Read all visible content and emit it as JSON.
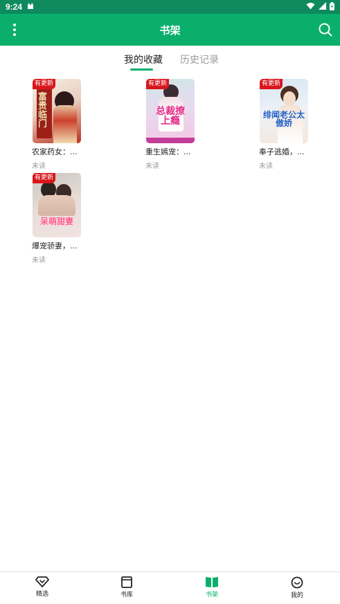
{
  "status": {
    "time": "9:24"
  },
  "header": {
    "title": "书架"
  },
  "tabs": [
    {
      "label": "我的收藏",
      "active": true
    },
    {
      "label": "历史记录",
      "active": false
    }
  ],
  "books": [
    {
      "title": "农家药女：...",
      "status": "未读",
      "badge": "有更新",
      "cover_text": "富贵临门"
    },
    {
      "title": "重生嫣宠：...",
      "status": "未读",
      "badge": "有更新",
      "cover_text": "总裁撩上瘾"
    },
    {
      "title": "奉子逃婚，...",
      "status": "未读",
      "badge": "有更新",
      "cover_text": "绯闻老公太傲娇"
    },
    {
      "title": "爆宠骄妻，...",
      "status": "未读",
      "badge": "有更新",
      "cover_text": "呆萌甜妻"
    }
  ],
  "bottom_nav": [
    {
      "label": "精选",
      "icon": "diamond-icon",
      "active": false
    },
    {
      "label": "书库",
      "icon": "library-icon",
      "active": false
    },
    {
      "label": "书架",
      "icon": "bookshelf-icon",
      "active": true
    },
    {
      "label": "我的",
      "icon": "smiley-icon",
      "active": false
    }
  ],
  "colors": {
    "primary": "#0aaf6b",
    "status_bar": "#0e8a5e",
    "badge": "#d9161d"
  }
}
